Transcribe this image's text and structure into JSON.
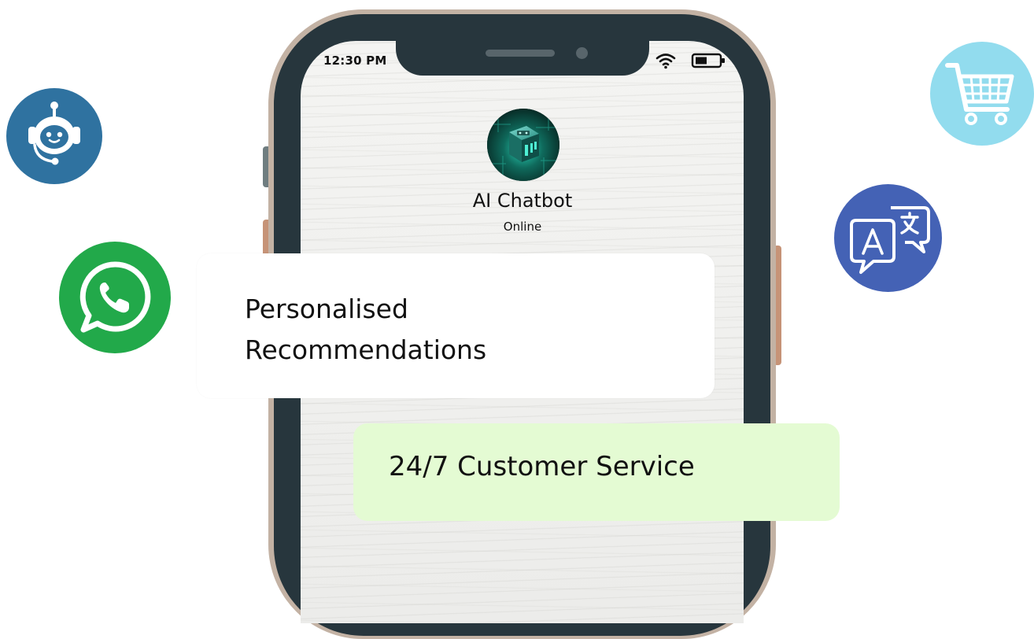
{
  "status_bar": {
    "time": "12:30 PM",
    "wifi_icon": "wifi-icon",
    "battery_icon": "battery-icon"
  },
  "chat": {
    "avatar": "bot-avatar-chip-image",
    "name": "AI Chatbot",
    "status": "Online"
  },
  "messages": {
    "recommendations": "Personalised\nRecommendations",
    "service": "24/7 Customer Service"
  },
  "floating_icons": [
    {
      "name": "chatbot-icon",
      "color": "#2f72a0"
    },
    {
      "name": "whatsapp-icon",
      "color": "#22a94a"
    },
    {
      "name": "shopping-cart-icon",
      "color": "#92dcee"
    },
    {
      "name": "translate-icon",
      "color": "#4462b5"
    }
  ],
  "colors": {
    "phone_body": "#27363d",
    "phone_frame": "#c3b2a4",
    "service_bubble": "#e4fbd3",
    "recommend_bubble": "#ffffff"
  }
}
